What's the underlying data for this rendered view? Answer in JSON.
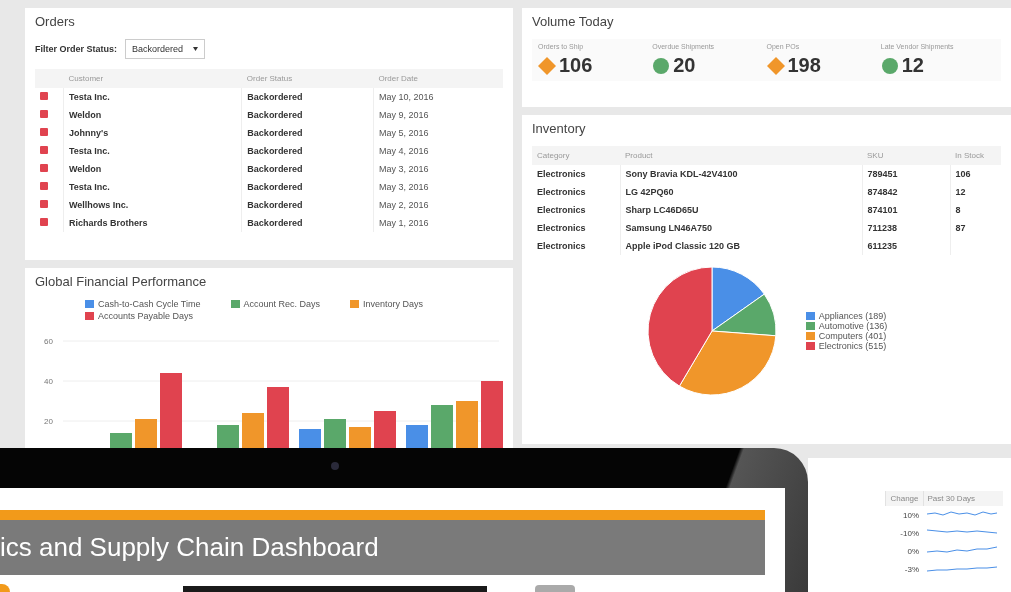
{
  "orders": {
    "title": "Orders",
    "filter_label": "Filter Order Status:",
    "filter_value": "Backordered",
    "columns": [
      "Customer",
      "Order Status",
      "Order Date"
    ],
    "rows": [
      {
        "color": "#e0434f",
        "customer": "Testa Inc.",
        "status": "Backordered",
        "date": "May 10, 2016"
      },
      {
        "color": "#e0434f",
        "customer": "Weldon",
        "status": "Backordered",
        "date": "May 9, 2016"
      },
      {
        "color": "#e0434f",
        "customer": "Johnny's",
        "status": "Backordered",
        "date": "May 5, 2016"
      },
      {
        "color": "#e0434f",
        "customer": "Testa Inc.",
        "status": "Backordered",
        "date": "May 4, 2016"
      },
      {
        "color": "#e0434f",
        "customer": "Weldon",
        "status": "Backordered",
        "date": "May 3, 2016"
      },
      {
        "color": "#e0434f",
        "customer": "Testa Inc.",
        "status": "Backordered",
        "date": "May 3, 2016"
      },
      {
        "color": "#e0434f",
        "customer": "Wellhows Inc.",
        "status": "Backordered",
        "date": "May 2, 2016"
      },
      {
        "color": "#e0434f",
        "customer": "Richards Brothers",
        "status": "Backordered",
        "date": "May 1, 2016"
      }
    ]
  },
  "volume_today": {
    "title": "Volume Today",
    "kpis": [
      {
        "label": "Orders to Ship",
        "value": "106",
        "kind": "diamond",
        "color": "#f0962a"
      },
      {
        "label": "Overdue Shipments",
        "value": "20",
        "kind": "circle",
        "color": "#5aa86a"
      },
      {
        "label": "Open POs",
        "value": "198",
        "kind": "diamond",
        "color": "#f0962a"
      },
      {
        "label": "Late Vendor Shipments",
        "value": "12",
        "kind": "circle",
        "color": "#5aa86a"
      }
    ]
  },
  "inventory": {
    "title": "Inventory",
    "columns": [
      "Category",
      "Product",
      "SKU",
      "In Stock"
    ],
    "rows": [
      [
        "Electronics",
        "Sony Bravia KDL-42V4100",
        "789451",
        "106"
      ],
      [
        "Electronics",
        "LG 42PQ60",
        "874842",
        "12"
      ],
      [
        "Electronics",
        "Sharp LC46D65U",
        "874101",
        "8"
      ],
      [
        "Electronics",
        "Samsung LN46A750",
        "711238",
        "87"
      ],
      [
        "Electronics",
        "Apple iPod Classic 120 GB",
        "611235",
        ""
      ]
    ],
    "chart_data": {
      "type": "pie",
      "categories": [
        "Appliances (189)",
        "Automotive (136)",
        "Computers (401)",
        "Electronics (515)"
      ],
      "values": [
        189,
        136,
        401,
        515
      ],
      "legend": "right",
      "colors": [
        "#4a8fe7",
        "#5aa86a",
        "#f0962a",
        "#e0434f"
      ]
    }
  },
  "financial": {
    "title": "Global Financial Performance",
    "chart_data": {
      "type": "bar",
      "legend": "top",
      "ylim": [
        0,
        60
      ],
      "yticks": [
        20,
        40,
        60
      ],
      "series": [
        {
          "name": "Cash-to-Cash Cycle Time",
          "color": "#4a8fe7",
          "values": [
            null,
            null,
            16,
            18
          ]
        },
        {
          "name": "Account Rec. Days",
          "color": "#5aa86a",
          "values": [
            14,
            18,
            21,
            28
          ]
        },
        {
          "name": "Inventory Days",
          "color": "#f0962a",
          "values": [
            21,
            24,
            17,
            30
          ]
        },
        {
          "name": "Accounts Payable Days",
          "color": "#e0434f",
          "values": [
            44,
            37,
            25,
            40
          ]
        }
      ]
    }
  },
  "trend_table": {
    "columns": [
      "Change",
      "Past 30 Days"
    ],
    "rows": [
      "10%",
      "-10%",
      "0%",
      "-3%"
    ]
  },
  "tablet": {
    "title": "ics and Supply Chain Dashboard"
  }
}
